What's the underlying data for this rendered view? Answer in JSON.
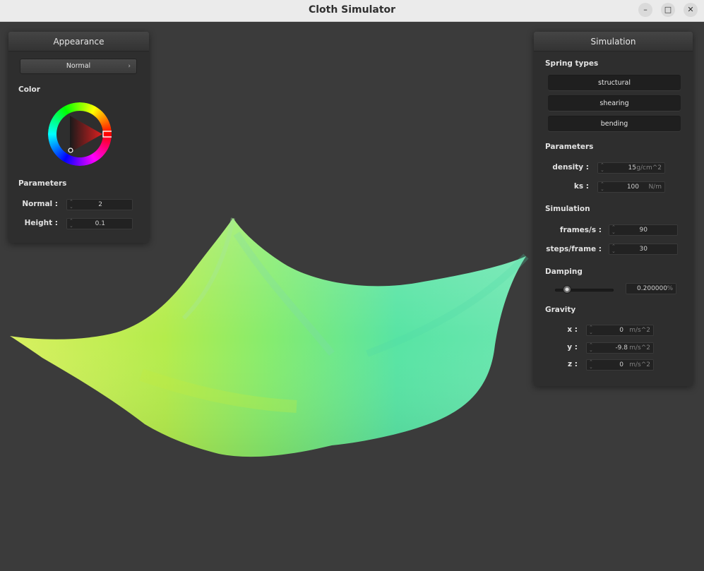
{
  "window": {
    "title": "Cloth Simulator"
  },
  "appearance": {
    "title": "Appearance",
    "shader": "Normal",
    "color_label": "Color",
    "color": "#cc2222",
    "parameters_label": "Parameters",
    "normal_label": "Normal :",
    "normal_value": "2",
    "height_label": "Height :",
    "height_value": "0.1"
  },
  "simulation_panel": {
    "title": "Simulation",
    "spring_types_label": "Spring types",
    "spring_types": [
      "structural",
      "shearing",
      "bending"
    ],
    "parameters_label": "Parameters",
    "density_label": "density :",
    "density_value": "15",
    "density_unit": "g/cm^2",
    "ks_label": "ks :",
    "ks_value": "100",
    "ks_unit": "N/m",
    "simulation_label": "Simulation",
    "fps_label": "frames/s :",
    "fps_value": "90",
    "steps_label": "steps/frame :",
    "steps_value": "30",
    "damping_label": "Damping",
    "damping_value": "0.200000",
    "damping_unit": "%",
    "damping_fraction": 0.2,
    "gravity_label": "Gravity",
    "gravity_x_label": "x :",
    "gravity_x": "0",
    "gravity_y_label": "y :",
    "gravity_y": "-9.8",
    "gravity_z_label": "z :",
    "gravity_z": "0",
    "gravity_unit": "m/s^2"
  }
}
